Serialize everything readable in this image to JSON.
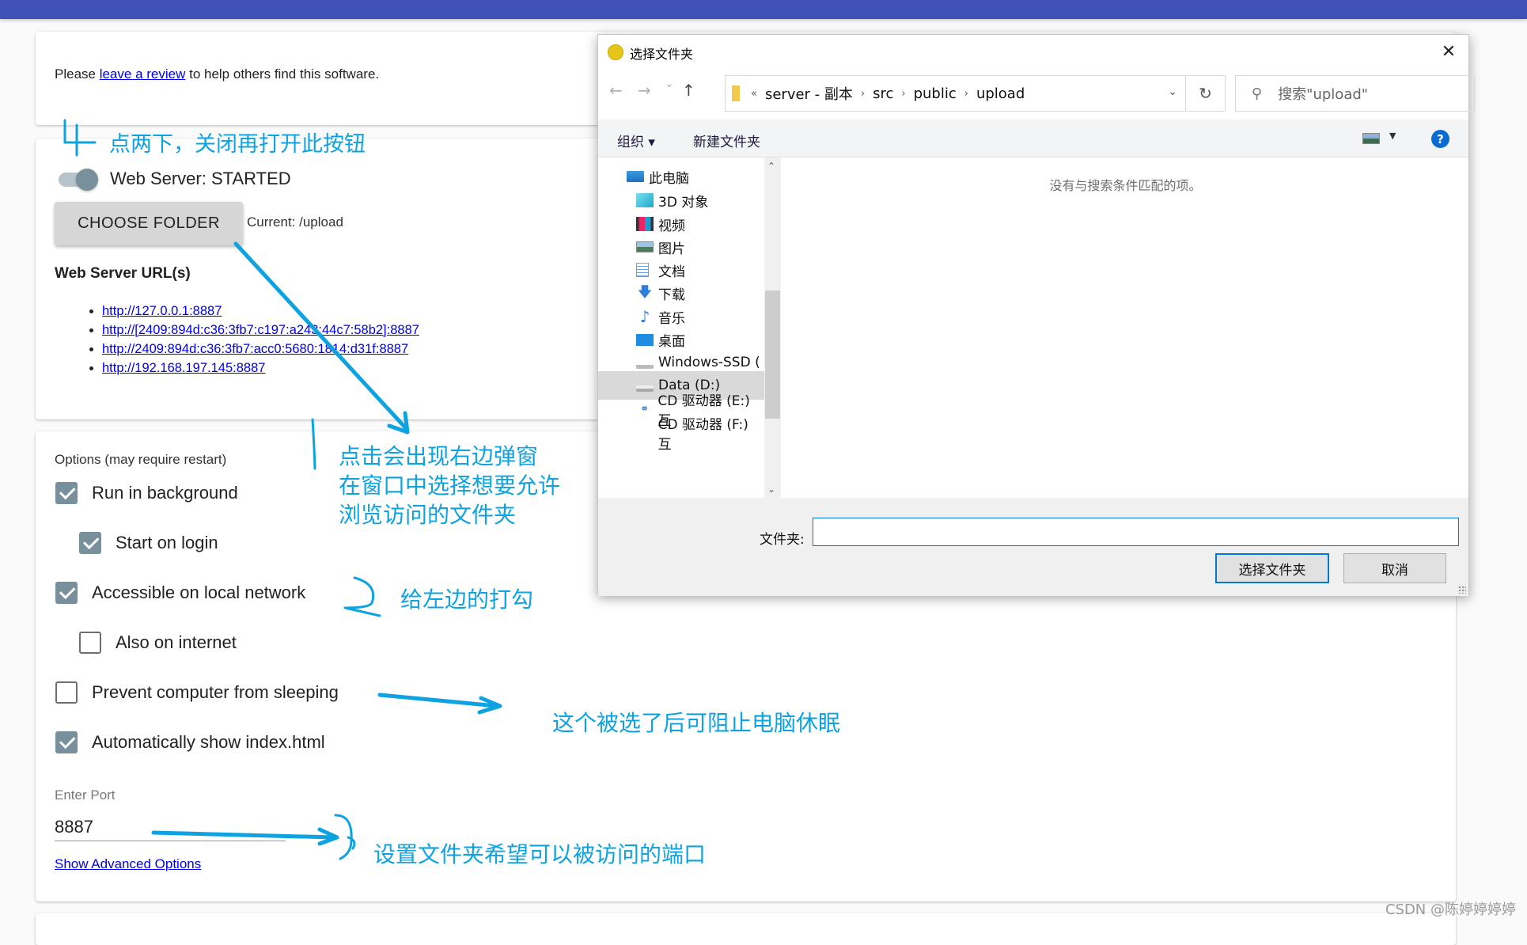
{
  "app": {
    "header_color": "#3f51b5",
    "review": {
      "prefix": "Please ",
      "link": "leave a review",
      "suffix": " to help others find this software."
    },
    "server": {
      "toggle_on": true,
      "status_label": "Web Server: STARTED",
      "choose_folder_label": "CHOOSE FOLDER",
      "current_folder": "Current: /upload",
      "urls_title": "Web Server URL(s)",
      "urls": [
        "http://127.0.0.1:8887",
        "http://[2409:894d:c36:3fb7:c197:a243:44c7:58b2]:8887",
        "http://2409:894d:c36:3fb7:acc0:5680:1814:d31f:8887",
        "http://192.168.197.145:8887"
      ]
    },
    "options": {
      "title": "Options (may require restart)",
      "items": [
        {
          "label": "Run in background",
          "checked": true
        },
        {
          "label": "Start on login",
          "checked": true
        },
        {
          "label": "Accessible on local network",
          "checked": true
        },
        {
          "label": "Also on internet",
          "checked": false
        },
        {
          "label": "Prevent computer from sleeping",
          "checked": false
        },
        {
          "label": "Automatically show index.html",
          "checked": true
        }
      ],
      "port_label": "Enter Port",
      "port_value": "8887",
      "advanced_link": "Show Advanced Options"
    }
  },
  "dialog": {
    "title": "选择文件夹",
    "close_glyph": "✕",
    "nav": {
      "back": "←",
      "forward": "→",
      "recent": "⌄",
      "up": "↑"
    },
    "address": {
      "overflow": "«",
      "crumbs": [
        "server - 副本",
        "src",
        "public",
        "upload"
      ],
      "separator": "›",
      "dropdown": "⌄"
    },
    "refresh_glyph": "↻",
    "search_placeholder": "搜索\"upload\"",
    "toolbar": {
      "organize": "组织 ▾",
      "new_folder": "新建文件夹",
      "view_dd": "▼",
      "help": "?"
    },
    "nav_pane": [
      {
        "label": "此电脑",
        "icon": "computer-icon"
      },
      {
        "label": "3D 对象",
        "icon": "cube-icon"
      },
      {
        "label": "视频",
        "icon": "video-icon"
      },
      {
        "label": "图片",
        "icon": "picture-icon"
      },
      {
        "label": "文档",
        "icon": "document-icon"
      },
      {
        "label": "下载",
        "icon": "download-icon"
      },
      {
        "label": "音乐",
        "icon": "music-icon"
      },
      {
        "label": "桌面",
        "icon": "desktop-icon"
      },
      {
        "label": "Windows-SSD (",
        "icon": "drive-icon"
      },
      {
        "label": "Data (D:)",
        "icon": "drive-icon",
        "selected": true
      },
      {
        "label": "CD 驱动器 (E:) 互",
        "icon": "cd-drive-icon"
      },
      {
        "label": "CD 驱动器 (F:) 互",
        "icon": "cd-drive-icon"
      }
    ],
    "empty_message": "没有与搜索条件匹配的项。",
    "folder_label": "文件夹:",
    "folder_value": "",
    "ok_label": "选择文件夹",
    "cancel_label": "取消"
  },
  "annotations": {
    "step_number": "4",
    "step_note": "点两下，关闭再打开此按钮",
    "dialog_note": [
      "点击会出现右边弹窗",
      "在窗口中选择想要允许",
      "浏览访问的文件夹"
    ],
    "check_number": "2",
    "check_note": "给左边的打勾",
    "sleep_note": "这个被选了后可阻止电脑休眠",
    "port_number": "3",
    "port_note": "设置文件夹希望可以被访问的端口",
    "color": "#0ea2e0"
  },
  "watermark": "CSDN @陈婷婷婷婷"
}
